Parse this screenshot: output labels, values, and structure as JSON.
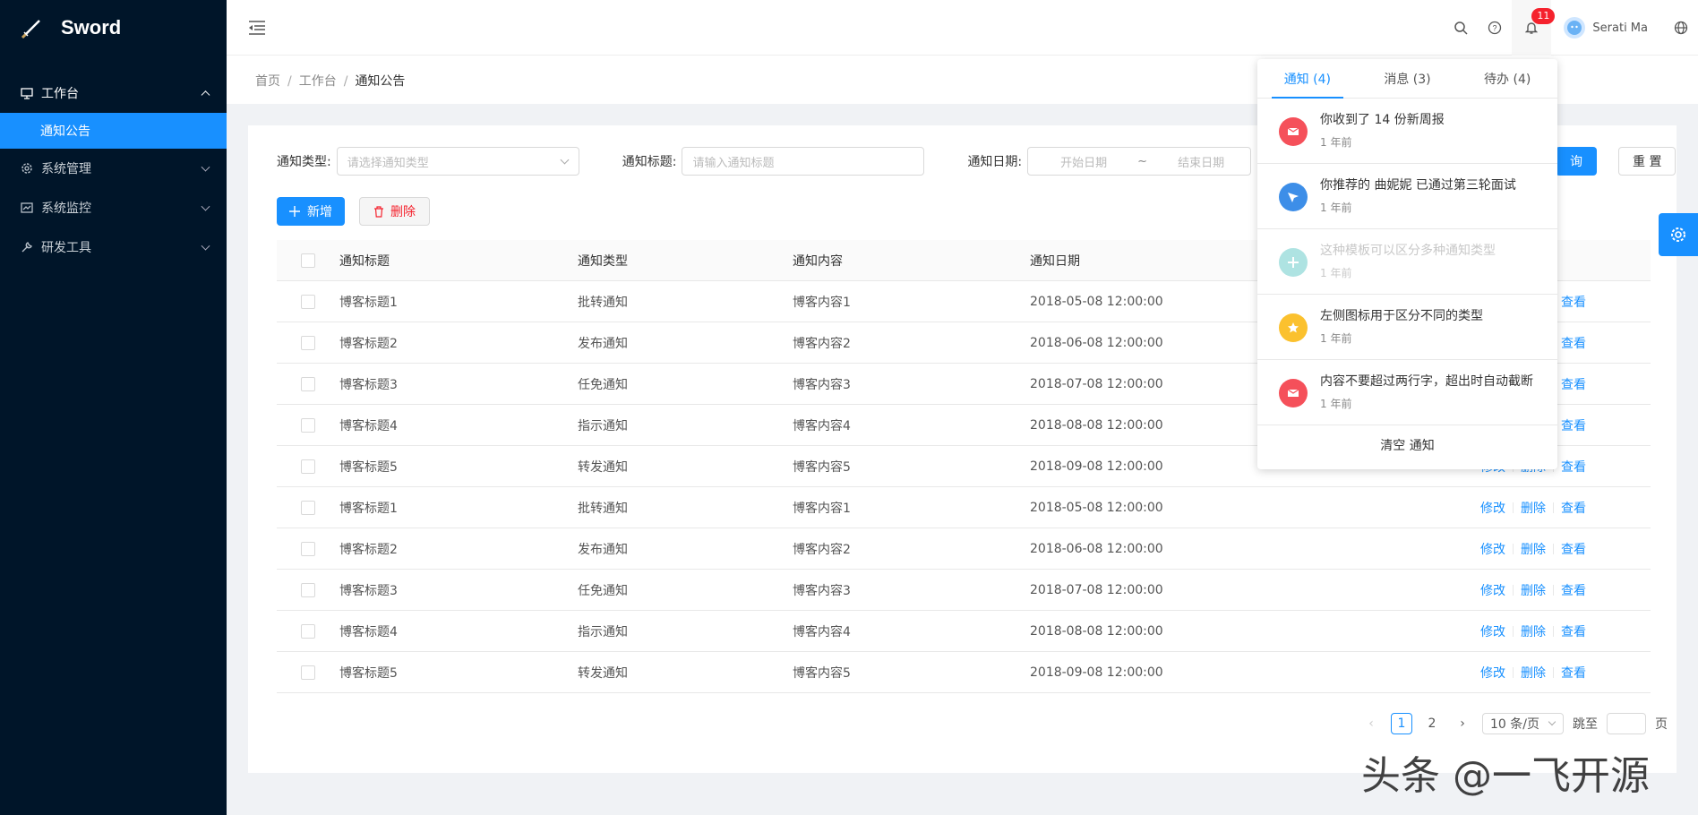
{
  "app": {
    "name": "Sword"
  },
  "sidebar": {
    "items": [
      {
        "label": "工作台",
        "icon": "monitor-icon",
        "open": true
      },
      {
        "label": "系统管理",
        "icon": "gear-icon"
      },
      {
        "label": "系统监控",
        "icon": "chart-icon"
      },
      {
        "label": "研发工具",
        "icon": "wrench-icon"
      }
    ],
    "sub_active": "通知公告"
  },
  "header": {
    "notif_count": "11",
    "user_name": "Serati Ma"
  },
  "breadcrumb": [
    "首页",
    "工作台",
    "通知公告"
  ],
  "filters": {
    "type_label": "通知类型:",
    "type_placeholder": "请选择通知类型",
    "title_label": "通知标题:",
    "title_placeholder": "请输入通知标题",
    "date_label": "通知日期:",
    "date_start": "开始日期",
    "date_sep": "~",
    "date_end": "结束日期",
    "search_button": "询",
    "reset_button": "重 置"
  },
  "toolbar": {
    "add_label": "新增",
    "delete_label": "删除"
  },
  "table": {
    "columns": [
      "通知标题",
      "通知类型",
      "通知内容",
      "通知日期"
    ],
    "op_labels": [
      "修改",
      "删除",
      "查看"
    ],
    "rows": [
      [
        "博客标题1",
        "批转通知",
        "博客内容1",
        "2018-05-08 12:00:00"
      ],
      [
        "博客标题2",
        "发布通知",
        "博客内容2",
        "2018-06-08 12:00:00"
      ],
      [
        "博客标题3",
        "任免通知",
        "博客内容3",
        "2018-07-08 12:00:00"
      ],
      [
        "博客标题4",
        "指示通知",
        "博客内容4",
        "2018-08-08 12:00:00"
      ],
      [
        "博客标题5",
        "转发通知",
        "博客内容5",
        "2018-09-08 12:00:00"
      ],
      [
        "博客标题1",
        "批转通知",
        "博客内容1",
        "2018-05-08 12:00:00"
      ],
      [
        "博客标题2",
        "发布通知",
        "博客内容2",
        "2018-06-08 12:00:00"
      ],
      [
        "博客标题3",
        "任免通知",
        "博客内容3",
        "2018-07-08 12:00:00"
      ],
      [
        "博客标题4",
        "指示通知",
        "博客内容4",
        "2018-08-08 12:00:00"
      ],
      [
        "博客标题5",
        "转发通知",
        "博客内容5",
        "2018-09-08 12:00:00"
      ]
    ]
  },
  "pagination": {
    "pages": [
      "1",
      "2"
    ],
    "current": "1",
    "page_size": "10 条/页",
    "jump_label": "跳至",
    "page_suffix": "页"
  },
  "notice": {
    "tabs": [
      "通知 (4)",
      "消息 (3)",
      "待办 (4)"
    ],
    "items": [
      {
        "title": "你收到了 14 份新周报",
        "time": "1 年前",
        "icon": "mail-icon",
        "color": "#f5505a",
        "read": false
      },
      {
        "title": "你推荐的 曲妮妮 已通过第三轮面试",
        "time": "1 年前",
        "icon": "send-icon",
        "color": "#3d8ee8",
        "read": false
      },
      {
        "title": "这种模板可以区分多种通知类型",
        "time": "1 年前",
        "icon": "plus-icon",
        "color": "#aee3e2",
        "read": true
      },
      {
        "title": "左侧图标用于区分不同的类型",
        "time": "1 年前",
        "icon": "star-icon",
        "color": "#fbc12e",
        "read": false
      },
      {
        "title": "内容不要超过两行字，超出时自动截断",
        "time": "1 年前",
        "icon": "mail-icon",
        "color": "#f5505a",
        "read": false
      }
    ],
    "clear_label": "清空 通知"
  },
  "watermark": "头条 @一飞开源",
  "colors": {
    "primary": "#1890ff",
    "sidebar": "#001529",
    "danger": "#f5222d"
  }
}
